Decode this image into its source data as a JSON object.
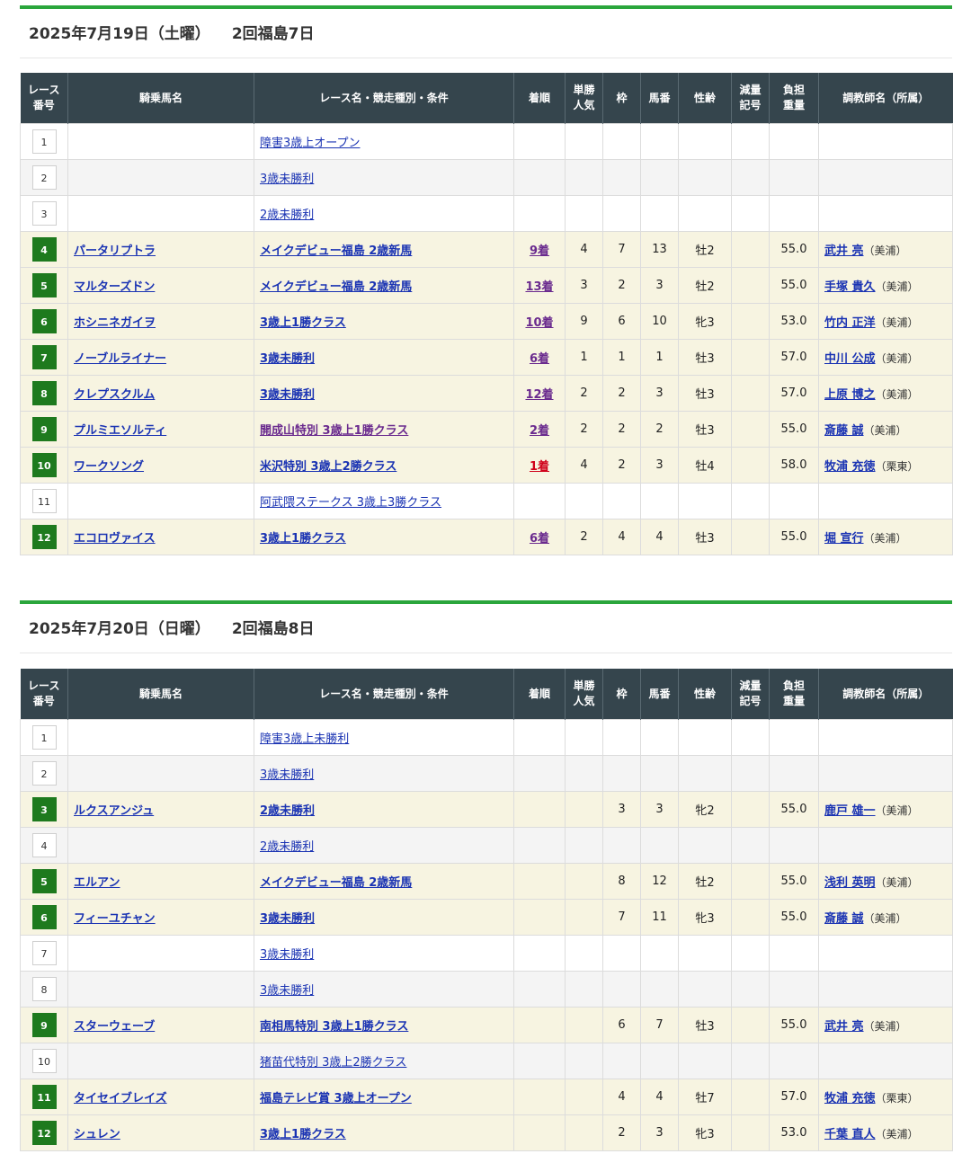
{
  "headers": [
    "レース番号",
    "騎乗馬名",
    "レース名・競走種別・条件",
    "着順",
    "単勝人気",
    "枠",
    "馬番",
    "性齢",
    "減量記号",
    "負担重量",
    "調教師名（所属）"
  ],
  "days": [
    {
      "date": "2025年7月19日（土曜）",
      "meeting": "2回福島7日",
      "rows": [
        {
          "no": "1",
          "horse": "",
          "race": "障害3歳上オープン",
          "finish": "",
          "pop": "",
          "waku": "",
          "umaban": "",
          "sexage": "",
          "gen": "",
          "weight": "",
          "trainer": "",
          "area": "",
          "ride": false,
          "raceVisited": false,
          "finishType": ""
        },
        {
          "no": "2",
          "horse": "",
          "race": "3歳未勝利",
          "finish": "",
          "pop": "",
          "waku": "",
          "umaban": "",
          "sexage": "",
          "gen": "",
          "weight": "",
          "trainer": "",
          "area": "",
          "ride": false,
          "raceVisited": false,
          "finishType": ""
        },
        {
          "no": "3",
          "horse": "",
          "race": "2歳未勝利",
          "finish": "",
          "pop": "",
          "waku": "",
          "umaban": "",
          "sexage": "",
          "gen": "",
          "weight": "",
          "trainer": "",
          "area": "",
          "ride": false,
          "raceVisited": false,
          "finishType": ""
        },
        {
          "no": "4",
          "horse": "パータリプトラ",
          "race": "メイクデビュー福島 2歳新馬",
          "finish": "9着",
          "pop": "4",
          "waku": "7",
          "umaban": "13",
          "sexage": "牡2",
          "gen": "",
          "weight": "55.0",
          "trainer": "武井 亮",
          "area": "（美浦）",
          "ride": true,
          "raceVisited": false,
          "finishType": "pos"
        },
        {
          "no": "5",
          "horse": "マルターズドン",
          "race": "メイクデビュー福島 2歳新馬",
          "finish": "13着",
          "pop": "3",
          "waku": "2",
          "umaban": "3",
          "sexage": "牡2",
          "gen": "",
          "weight": "55.0",
          "trainer": "手塚 貴久",
          "area": "（美浦）",
          "ride": true,
          "raceVisited": false,
          "finishType": "pos"
        },
        {
          "no": "6",
          "horse": "ホシニネガイヲ",
          "race": "3歳上1勝クラス",
          "finish": "10着",
          "pop": "9",
          "waku": "6",
          "umaban": "10",
          "sexage": "牝3",
          "gen": "",
          "weight": "53.0",
          "trainer": "竹内 正洋",
          "area": "（美浦）",
          "ride": true,
          "raceVisited": false,
          "finishType": "pos"
        },
        {
          "no": "7",
          "horse": "ノーブルライナー",
          "race": "3歳未勝利",
          "finish": "6着",
          "pop": "1",
          "waku": "1",
          "umaban": "1",
          "sexage": "牡3",
          "gen": "",
          "weight": "57.0",
          "trainer": "中川 公成",
          "area": "（美浦）",
          "ride": true,
          "raceVisited": false,
          "finishType": "pos"
        },
        {
          "no": "8",
          "horse": "クレプスクルム",
          "race": "3歳未勝利",
          "finish": "12着",
          "pop": "2",
          "waku": "2",
          "umaban": "3",
          "sexage": "牡3",
          "gen": "",
          "weight": "57.0",
          "trainer": "上原 博之",
          "area": "（美浦）",
          "ride": true,
          "raceVisited": false,
          "finishType": "pos"
        },
        {
          "no": "9",
          "horse": "プルミエソルティ",
          "race": "開成山特別 3歳上1勝クラス",
          "finish": "2着",
          "pop": "2",
          "waku": "2",
          "umaban": "2",
          "sexage": "牡3",
          "gen": "",
          "weight": "55.0",
          "trainer": "斎藤 誠",
          "area": "（美浦）",
          "ride": true,
          "raceVisited": true,
          "finishType": "pos"
        },
        {
          "no": "10",
          "horse": "ワークソング",
          "race": "米沢特別 3歳上2勝クラス",
          "finish": "1着",
          "pop": "4",
          "waku": "2",
          "umaban": "3",
          "sexage": "牡4",
          "gen": "",
          "weight": "58.0",
          "trainer": "牧浦 充徳",
          "area": "（栗東）",
          "ride": true,
          "raceVisited": false,
          "finishType": "win"
        },
        {
          "no": "11",
          "horse": "",
          "race": "阿武隈ステークス 3歳上3勝クラス",
          "finish": "",
          "pop": "",
          "waku": "",
          "umaban": "",
          "sexage": "",
          "gen": "",
          "weight": "",
          "trainer": "",
          "area": "",
          "ride": false,
          "raceVisited": false,
          "finishType": ""
        },
        {
          "no": "12",
          "horse": "エコロヴァイス",
          "race": "3歳上1勝クラス",
          "finish": "6着",
          "pop": "2",
          "waku": "4",
          "umaban": "4",
          "sexage": "牡3",
          "gen": "",
          "weight": "55.0",
          "trainer": "堀 宣行",
          "area": "（美浦）",
          "ride": true,
          "raceVisited": false,
          "finishType": "pos"
        }
      ]
    },
    {
      "date": "2025年7月20日（日曜）",
      "meeting": "2回福島8日",
      "rows": [
        {
          "no": "1",
          "horse": "",
          "race": "障害3歳上未勝利",
          "finish": "",
          "pop": "",
          "waku": "",
          "umaban": "",
          "sexage": "",
          "gen": "",
          "weight": "",
          "trainer": "",
          "area": "",
          "ride": false,
          "raceVisited": false,
          "finishType": ""
        },
        {
          "no": "2",
          "horse": "",
          "race": "3歳未勝利",
          "finish": "",
          "pop": "",
          "waku": "",
          "umaban": "",
          "sexage": "",
          "gen": "",
          "weight": "",
          "trainer": "",
          "area": "",
          "ride": false,
          "raceVisited": false,
          "finishType": ""
        },
        {
          "no": "3",
          "horse": "ルクスアンジュ",
          "race": "2歳未勝利",
          "finish": "",
          "pop": "",
          "waku": "3",
          "umaban": "3",
          "sexage": "牝2",
          "gen": "",
          "weight": "55.0",
          "trainer": "鹿戸 雄一",
          "area": "（美浦）",
          "ride": true,
          "raceVisited": false,
          "finishType": ""
        },
        {
          "no": "4",
          "horse": "",
          "race": "2歳未勝利",
          "finish": "",
          "pop": "",
          "waku": "",
          "umaban": "",
          "sexage": "",
          "gen": "",
          "weight": "",
          "trainer": "",
          "area": "",
          "ride": false,
          "raceVisited": false,
          "finishType": ""
        },
        {
          "no": "5",
          "horse": "エルアン",
          "race": "メイクデビュー福島 2歳新馬",
          "finish": "",
          "pop": "",
          "waku": "8",
          "umaban": "12",
          "sexage": "牡2",
          "gen": "",
          "weight": "55.0",
          "trainer": "浅利 英明",
          "area": "（美浦）",
          "ride": true,
          "raceVisited": false,
          "finishType": ""
        },
        {
          "no": "6",
          "horse": "フィーユチャン",
          "race": "3歳未勝利",
          "finish": "",
          "pop": "",
          "waku": "7",
          "umaban": "11",
          "sexage": "牝3",
          "gen": "",
          "weight": "55.0",
          "trainer": "斎藤 誠",
          "area": "（美浦）",
          "ride": true,
          "raceVisited": false,
          "finishType": ""
        },
        {
          "no": "7",
          "horse": "",
          "race": "3歳未勝利",
          "finish": "",
          "pop": "",
          "waku": "",
          "umaban": "",
          "sexage": "",
          "gen": "",
          "weight": "",
          "trainer": "",
          "area": "",
          "ride": false,
          "raceVisited": false,
          "finishType": ""
        },
        {
          "no": "8",
          "horse": "",
          "race": "3歳未勝利",
          "finish": "",
          "pop": "",
          "waku": "",
          "umaban": "",
          "sexage": "",
          "gen": "",
          "weight": "",
          "trainer": "",
          "area": "",
          "ride": false,
          "raceVisited": false,
          "finishType": ""
        },
        {
          "no": "9",
          "horse": "スターウェーブ",
          "race": "南相馬特別 3歳上1勝クラス",
          "finish": "",
          "pop": "",
          "waku": "6",
          "umaban": "7",
          "sexage": "牡3",
          "gen": "",
          "weight": "55.0",
          "trainer": "武井 亮",
          "area": "（美浦）",
          "ride": true,
          "raceVisited": false,
          "finishType": ""
        },
        {
          "no": "10",
          "horse": "",
          "race": "猪苗代特別 3歳上2勝クラス",
          "finish": "",
          "pop": "",
          "waku": "",
          "umaban": "",
          "sexage": "",
          "gen": "",
          "weight": "",
          "trainer": "",
          "area": "",
          "ride": false,
          "raceVisited": false,
          "finishType": ""
        },
        {
          "no": "11",
          "horse": "タイセイブレイズ",
          "race": "福島テレビ賞 3歳上オープン",
          "finish": "",
          "pop": "",
          "waku": "4",
          "umaban": "4",
          "sexage": "牡7",
          "gen": "",
          "weight": "57.0",
          "trainer": "牧浦 充徳",
          "area": "（栗東）",
          "ride": true,
          "raceVisited": false,
          "finishType": ""
        },
        {
          "no": "12",
          "horse": "シュレン",
          "race": "3歳上1勝クラス",
          "finish": "",
          "pop": "",
          "waku": "2",
          "umaban": "3",
          "sexage": "牝3",
          "gen": "",
          "weight": "53.0",
          "trainer": "千葉 直人",
          "area": "（美浦）",
          "ride": true,
          "raceVisited": false,
          "finishType": ""
        }
      ]
    }
  ]
}
